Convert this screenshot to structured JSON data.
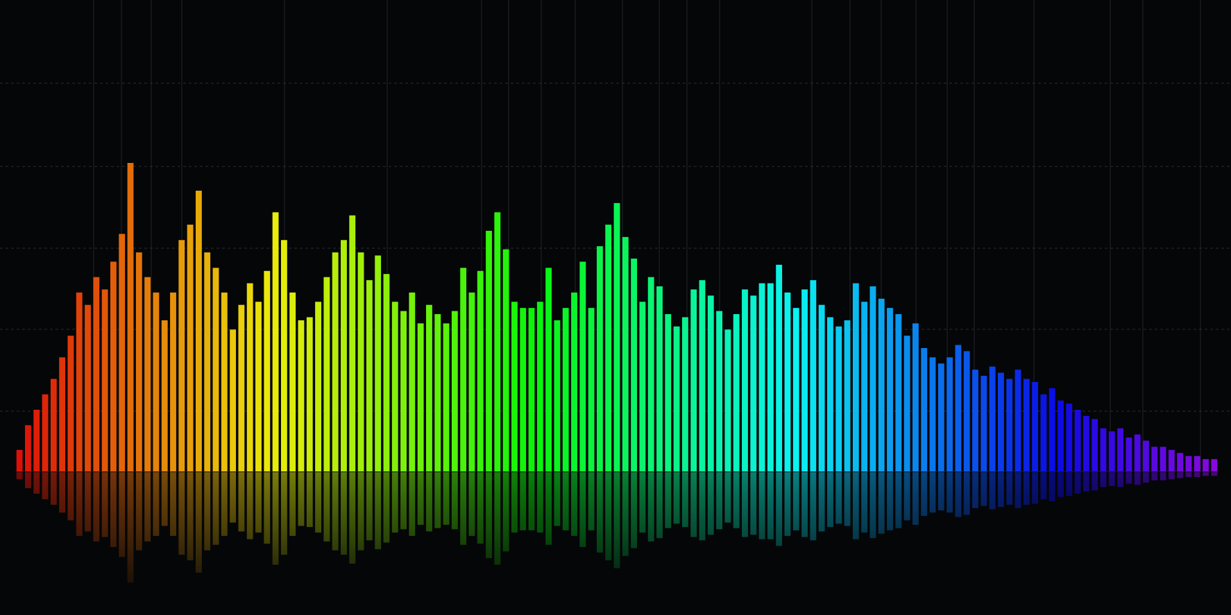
{
  "chart_data": {
    "type": "bar",
    "title": "",
    "xlabel": "",
    "ylabel": "",
    "grid": true,
    "legend": "none",
    "ylim": [
      0,
      1
    ],
    "reflection": true,
    "colors": {
      "background": "#050608",
      "grid": "#3a3d42",
      "gradient_start": "#d80f12",
      "gradient_end": "#8d1ff3"
    },
    "values": [
      0.07,
      0.15,
      0.2,
      0.25,
      0.3,
      0.37,
      0.44,
      0.58,
      0.54,
      0.63,
      0.59,
      0.68,
      0.77,
      1.0,
      0.71,
      0.63,
      0.58,
      0.49,
      0.58,
      0.75,
      0.8,
      0.91,
      0.71,
      0.66,
      0.58,
      0.46,
      0.54,
      0.61,
      0.55,
      0.65,
      0.84,
      0.75,
      0.58,
      0.49,
      0.5,
      0.55,
      0.63,
      0.71,
      0.75,
      0.83,
      0.71,
      0.62,
      0.7,
      0.64,
      0.55,
      0.52,
      0.58,
      0.48,
      0.54,
      0.51,
      0.48,
      0.52,
      0.66,
      0.58,
      0.65,
      0.78,
      0.84,
      0.72,
      0.55,
      0.53,
      0.53,
      0.55,
      0.66,
      0.49,
      0.53,
      0.58,
      0.68,
      0.53,
      0.73,
      0.8,
      0.87,
      0.76,
      0.69,
      0.55,
      0.63,
      0.6,
      0.51,
      0.47,
      0.5,
      0.59,
      0.62,
      0.57,
      0.52,
      0.46,
      0.51,
      0.59,
      0.57,
      0.61,
      0.61,
      0.67,
      0.58,
      0.53,
      0.59,
      0.62,
      0.54,
      0.5,
      0.47,
      0.49,
      0.61,
      0.55,
      0.6,
      0.56,
      0.53,
      0.51,
      0.44,
      0.48,
      0.4,
      0.37,
      0.35,
      0.37,
      0.41,
      0.39,
      0.33,
      0.31,
      0.34,
      0.32,
      0.3,
      0.33,
      0.3,
      0.29,
      0.25,
      0.27,
      0.23,
      0.22,
      0.2,
      0.18,
      0.17,
      0.14,
      0.13,
      0.14,
      0.11,
      0.12,
      0.1,
      0.08,
      0.08,
      0.07,
      0.06,
      0.05,
      0.05,
      0.04,
      0.04
    ]
  }
}
